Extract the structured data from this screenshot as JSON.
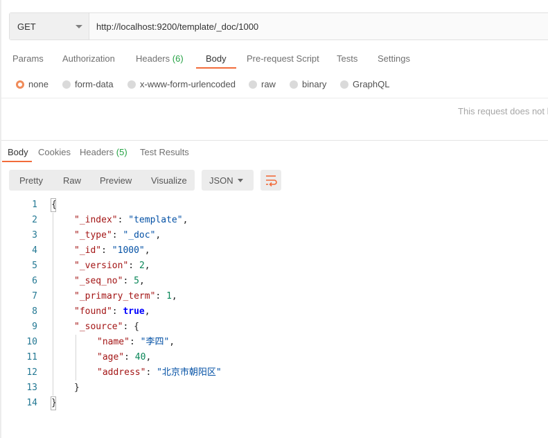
{
  "request": {
    "method": "GET",
    "url": "http://localhost:9200/template/_doc/1000"
  },
  "request_tabs": [
    {
      "label": "Params"
    },
    {
      "label": "Authorization"
    },
    {
      "label": "Headers",
      "count": "(6)"
    },
    {
      "label": "Body"
    },
    {
      "label": "Pre-request Script"
    },
    {
      "label": "Tests"
    },
    {
      "label": "Settings"
    }
  ],
  "active_request_tab": "Body",
  "body_types": [
    {
      "label": "none"
    },
    {
      "label": "form-data"
    },
    {
      "label": "x-www-form-urlencoded"
    },
    {
      "label": "raw"
    },
    {
      "label": "binary"
    },
    {
      "label": "GraphQL"
    }
  ],
  "selected_body_type": "none",
  "no_body_message": "This request does not h",
  "response_tabs": [
    {
      "label": "Body"
    },
    {
      "label": "Cookies"
    },
    {
      "label": "Headers",
      "count": "(5)"
    },
    {
      "label": "Test Results"
    }
  ],
  "active_response_tab": "Body",
  "view_modes": [
    {
      "label": "Pretty"
    },
    {
      "label": "Raw"
    },
    {
      "label": "Preview"
    },
    {
      "label": "Visualize"
    }
  ],
  "format": "JSON",
  "icons": {
    "method_dropdown": "chevron-down-icon",
    "format_dropdown": "chevron-down-icon",
    "wrap": "wrap-lines-icon"
  },
  "colors": {
    "accent": "#f26b3a",
    "count": "#25a244",
    "line_number": "#237893",
    "json_key": "#a31515",
    "json_string": "#0451a5",
    "json_number": "#098658",
    "json_bool": "#0000ff"
  },
  "code_lines": [
    {
      "num": "1",
      "text": "{"
    },
    {
      "num": "2",
      "key": "\"_index\"",
      "value": "\"template\"",
      "vtype": "s",
      "comma": ","
    },
    {
      "num": "3",
      "key": "\"_type\"",
      "value": "\"_doc\"",
      "vtype": "s",
      "comma": ","
    },
    {
      "num": "4",
      "key": "\"_id\"",
      "value": "\"1000\"",
      "vtype": "s",
      "comma": ","
    },
    {
      "num": "5",
      "key": "\"_version\"",
      "value": "2",
      "vtype": "n",
      "comma": ","
    },
    {
      "num": "6",
      "key": "\"_seq_no\"",
      "value": "5",
      "vtype": "n",
      "comma": ","
    },
    {
      "num": "7",
      "key": "\"_primary_term\"",
      "value": "1",
      "vtype": "n",
      "comma": ","
    },
    {
      "num": "8",
      "key": "\"found\"",
      "value": "true",
      "vtype": "b",
      "comma": ","
    },
    {
      "num": "9",
      "key": "\"_source\"",
      "value": "{",
      "vtype": "p",
      "comma": ""
    },
    {
      "num": "10",
      "key": "\"name\"",
      "value": "\"李四\"",
      "vtype": "s",
      "comma": ","
    },
    {
      "num": "11",
      "key": "\"age\"",
      "value": "40",
      "vtype": "n",
      "comma": ","
    },
    {
      "num": "12",
      "key": "\"address\"",
      "value": "\"北京市朝阳区\"",
      "vtype": "s",
      "comma": ""
    },
    {
      "num": "13",
      "text": "}"
    },
    {
      "num": "14",
      "text": "}"
    }
  ]
}
